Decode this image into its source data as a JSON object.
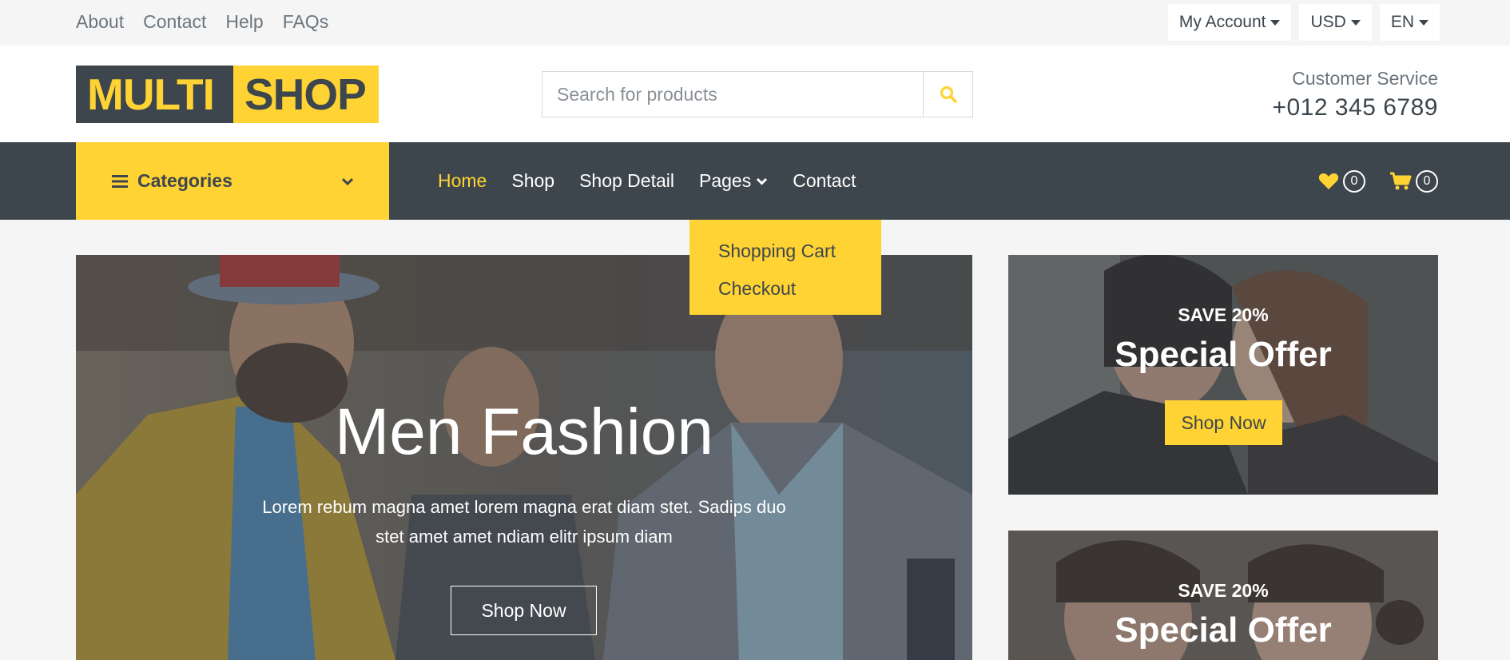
{
  "topbar": {
    "links": [
      "About",
      "Contact",
      "Help",
      "FAQs"
    ],
    "account_label": "My Account",
    "currency_label": "USD",
    "language_label": "EN"
  },
  "header": {
    "logo_part1": "MULTI",
    "logo_part2": "SHOP",
    "search_placeholder": "Search for products",
    "customer_service_label": "Customer Service",
    "customer_service_phone": "+012 345 6789"
  },
  "nav": {
    "categories_label": "Categories",
    "links": [
      {
        "label": "Home",
        "active": true
      },
      {
        "label": "Shop",
        "active": false
      },
      {
        "label": "Shop Detail",
        "active": false
      },
      {
        "label": "Pages",
        "active": false
      },
      {
        "label": "Contact",
        "active": false
      }
    ],
    "wishlist_count": "0",
    "cart_count": "0"
  },
  "pages_dropdown": {
    "items": [
      "Shopping Cart",
      "Checkout"
    ]
  },
  "carousel": {
    "title": "Men Fashion",
    "description": "Lorem rebum magna amet lorem magna erat diam stet. Sadips duo stet amet amet ndiam elitr ipsum diam",
    "button_label": "Shop Now"
  },
  "offers": [
    {
      "save": "SAVE 20%",
      "title": "Special Offer",
      "button_label": "Shop Now"
    },
    {
      "save": "SAVE 20%",
      "title": "Special Offer"
    }
  ],
  "colors": {
    "accent": "#FFD333",
    "dark": "#3D464D",
    "light_bg": "#F5F5F5"
  }
}
